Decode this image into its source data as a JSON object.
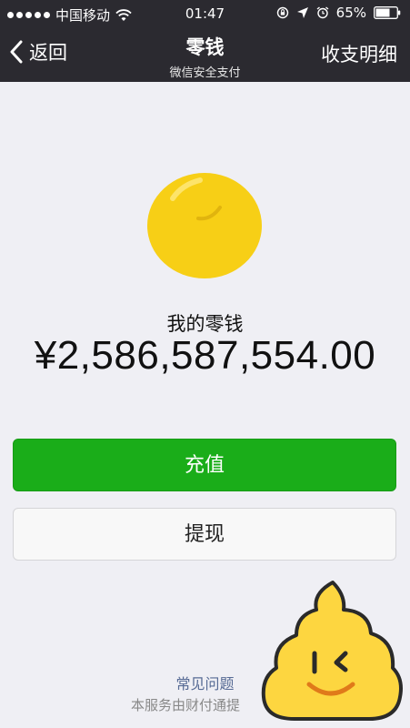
{
  "status_bar": {
    "carrier": "中国移动",
    "time": "01:47",
    "battery": "65%"
  },
  "nav": {
    "back_label": "返回",
    "title": "零钱",
    "subtitle": "微信安全支付",
    "history_label": "收支明细"
  },
  "wallet": {
    "balance_label": "我的零钱",
    "balance_amount": "¥2,586,587,554.00"
  },
  "actions": {
    "recharge_label": "充值",
    "withdraw_label": "提现"
  },
  "footer": {
    "faq_label": "常见问题",
    "service_text": "本服务由财付通提"
  },
  "colors": {
    "primary_green": "#1aad19",
    "nav_bg": "#2b2a30",
    "coin_yellow": "#f7cf16",
    "link_blue": "#576b95"
  },
  "icons": [
    "wifi-icon",
    "lock-rotation-icon",
    "location-arrow-icon",
    "alarm-icon",
    "battery-icon",
    "back-chevron-icon",
    "coin-icon"
  ]
}
